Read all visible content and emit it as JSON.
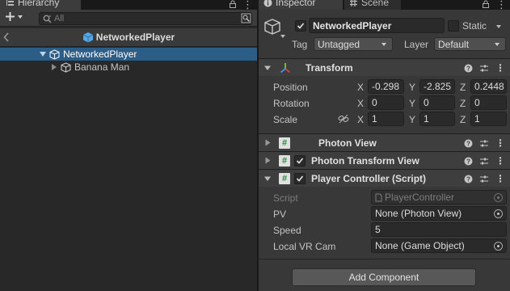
{
  "hierarchy": {
    "tab_label": "Hierarchy",
    "search_placeholder": "All",
    "scene_title": "NetworkedPlayer",
    "items": [
      {
        "label": "NetworkedPlayer",
        "selected": true
      },
      {
        "label": "Banana Man",
        "selected": false
      }
    ]
  },
  "inspector": {
    "tab_label": "Inspector",
    "scene_tab_label": "Scene",
    "object": {
      "name": "NetworkedPlayer",
      "active": true,
      "static_label": "Static",
      "tag_label": "Tag",
      "tag_value": "Untagged",
      "layer_label": "Layer",
      "layer_value": "Default"
    },
    "transform": {
      "title": "Transform",
      "position_label": "Position",
      "rotation_label": "Rotation",
      "scale_label": "Scale",
      "axes": {
        "x": "X",
        "y": "Y",
        "z": "Z"
      },
      "position": {
        "x": "-0.298",
        "y": "-2.825",
        "z": "0.2448"
      },
      "rotation": {
        "x": "0",
        "y": "0",
        "z": "0"
      },
      "scale": {
        "x": "1",
        "y": "1",
        "z": "1"
      }
    },
    "components": [
      {
        "title": "Photon View",
        "has_checkbox": false
      },
      {
        "title": "Photon Transform View",
        "has_checkbox": true
      },
      {
        "title": "Player Controller (Script)",
        "has_checkbox": true
      }
    ],
    "player_controller": {
      "script_label": "Script",
      "script_value": "PlayerController",
      "pv_label": "PV",
      "pv_value": "None (Photon View)",
      "speed_label": "Speed",
      "speed_value": "5",
      "vrcam_label": "Local VR Cam",
      "vrcam_value": "None (Game Object)"
    },
    "add_component_label": "Add Component"
  },
  "colors": {
    "selection": "#2c5d87",
    "panel_bg": "#383838",
    "hierarchy_bg": "#282828",
    "script_hash_green": "#2a8a3a"
  }
}
